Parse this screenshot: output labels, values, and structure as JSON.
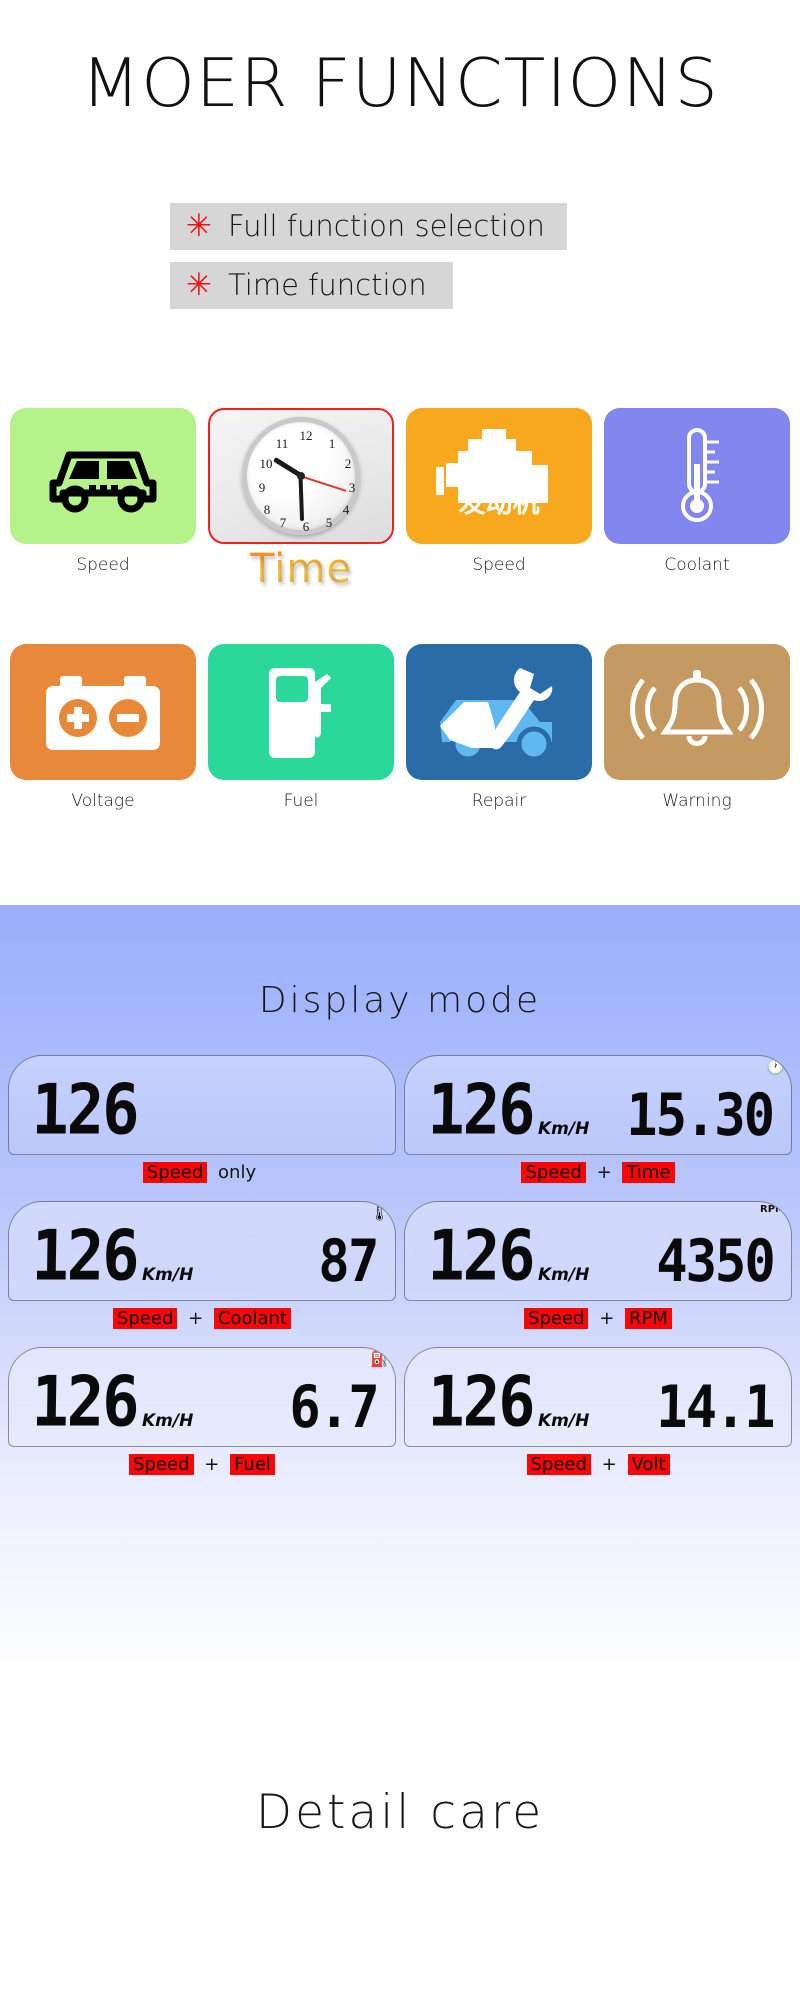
{
  "header": {
    "title": "MOER FUNCTIONS",
    "bullets": [
      {
        "star": "✳",
        "text": "Full function selection"
      },
      {
        "star": "✳",
        "text": "Time function"
      }
    ]
  },
  "icon_grid": {
    "rows": [
      [
        {
          "label": "Speed",
          "icon": "taxi-car-icon",
          "bg": "#b6f28a",
          "icon_color": "#000000"
        },
        {
          "label": "Time",
          "icon": "analog-clock-icon",
          "bg": "#eaeaea",
          "icon_color": "#1a1a1a",
          "outlined": true,
          "highlight": true
        },
        {
          "label": "Speed",
          "icon": "engine-icon",
          "bg": "#f8a81c",
          "icon_color": "#ffffff",
          "icon_text": "发动机"
        },
        {
          "label": "Coolant",
          "icon": "thermometer-icon",
          "bg": "#8187ef",
          "icon_color": "#ffffff"
        }
      ],
      [
        {
          "label": "Voltage",
          "icon": "battery-icon",
          "bg": "#e8893a",
          "icon_color": "#ffffff"
        },
        {
          "label": "Fuel",
          "icon": "fuel-pump-icon",
          "bg": "#2ad99a",
          "icon_color": "#ffffff"
        },
        {
          "label": "Repair",
          "icon": "car-repair-wrench-icon",
          "bg": "#2a6ca8",
          "icon_color": "#ffffff"
        },
        {
          "label": "Warning",
          "icon": "alarm-bell-icon",
          "bg": "#c49a62",
          "icon_color": "#ffffff"
        }
      ]
    ]
  },
  "display_mode": {
    "title": "Display mode",
    "clock_numbers": [
      "12",
      "1",
      "2",
      "3",
      "4",
      "5",
      "6",
      "7",
      "8",
      "9",
      "10",
      "11"
    ],
    "panels": [
      {
        "value": "126",
        "unit": "",
        "secondary": "",
        "secondary_unit": "",
        "mini_icon": "",
        "caption_parts": [
          {
            "text": "Speed",
            "highlight": true
          },
          {
            "text": "only",
            "highlight": false
          }
        ]
      },
      {
        "value": "126",
        "unit": "Km/H",
        "secondary": "15.30",
        "secondary_unit": "",
        "mini_icon": "clock-icon",
        "mini_icon_glyph": "🕐",
        "caption_parts": [
          {
            "text": "Speed",
            "highlight": true
          },
          {
            "text": "+",
            "highlight": false,
            "op": true
          },
          {
            "text": "Time",
            "highlight": true
          }
        ]
      },
      {
        "value": "126",
        "unit": "Km/H",
        "secondary": "87",
        "secondary_unit": "",
        "mini_icon": "coolant-temp-icon",
        "mini_icon_glyph": "🌡",
        "caption_parts": [
          {
            "text": "Speed",
            "highlight": true
          },
          {
            "text": "+",
            "highlight": false,
            "op": true
          },
          {
            "text": "Coolant",
            "highlight": true
          }
        ]
      },
      {
        "value": "126",
        "unit": "Km/H",
        "secondary": "4350",
        "secondary_unit": "",
        "mini_icon": "rpm-icon",
        "mini_icon_glyph": "RPM",
        "caption_parts": [
          {
            "text": "Speed",
            "highlight": true
          },
          {
            "text": "+",
            "highlight": false,
            "op": true
          },
          {
            "text": "RPM",
            "highlight": true
          }
        ]
      },
      {
        "value": "126",
        "unit": "Km/H",
        "secondary": "6.7",
        "secondary_unit": "",
        "mini_icon": "fuel-icon",
        "mini_icon_glyph": "⛽",
        "caption_parts": [
          {
            "text": "Speed",
            "highlight": true
          },
          {
            "text": "+",
            "highlight": false,
            "op": true
          },
          {
            "text": "Fuel",
            "highlight": true
          }
        ]
      },
      {
        "value": "126",
        "unit": "Km/H",
        "secondary": "14.1",
        "secondary_unit": "",
        "mini_icon": "",
        "mini_icon_glyph": "",
        "caption_parts": [
          {
            "text": "Speed",
            "highlight": true
          },
          {
            "text": "+",
            "highlight": false,
            "op": true
          },
          {
            "text": "Volt",
            "highlight": true
          }
        ]
      }
    ]
  },
  "footer": {
    "title": "Detail care"
  },
  "colors": {
    "highlight_red": "#fb0606",
    "star_red": "#ee1111",
    "bullet_bar_bg": "#d6d6d6",
    "display_bg_top": "#9aaefc"
  }
}
